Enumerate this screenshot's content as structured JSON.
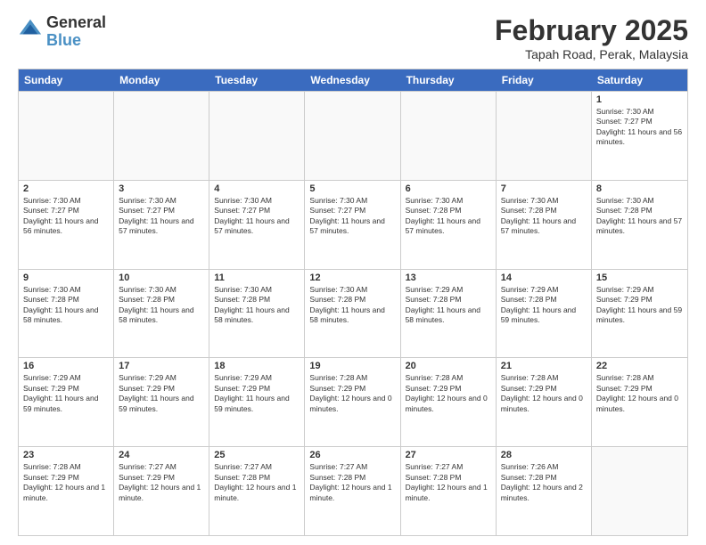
{
  "header": {
    "logo_general": "General",
    "logo_blue": "Blue",
    "month_year": "February 2025",
    "location": "Tapah Road, Perak, Malaysia"
  },
  "calendar": {
    "days_of_week": [
      "Sunday",
      "Monday",
      "Tuesday",
      "Wednesday",
      "Thursday",
      "Friday",
      "Saturday"
    ],
    "weeks": [
      [
        {
          "day": "",
          "info": ""
        },
        {
          "day": "",
          "info": ""
        },
        {
          "day": "",
          "info": ""
        },
        {
          "day": "",
          "info": ""
        },
        {
          "day": "",
          "info": ""
        },
        {
          "day": "",
          "info": ""
        },
        {
          "day": "1",
          "info": "Sunrise: 7:30 AM\nSunset: 7:27 PM\nDaylight: 11 hours and 56 minutes."
        }
      ],
      [
        {
          "day": "2",
          "info": "Sunrise: 7:30 AM\nSunset: 7:27 PM\nDaylight: 11 hours and 56 minutes."
        },
        {
          "day": "3",
          "info": "Sunrise: 7:30 AM\nSunset: 7:27 PM\nDaylight: 11 hours and 57 minutes."
        },
        {
          "day": "4",
          "info": "Sunrise: 7:30 AM\nSunset: 7:27 PM\nDaylight: 11 hours and 57 minutes."
        },
        {
          "day": "5",
          "info": "Sunrise: 7:30 AM\nSunset: 7:27 PM\nDaylight: 11 hours and 57 minutes."
        },
        {
          "day": "6",
          "info": "Sunrise: 7:30 AM\nSunset: 7:28 PM\nDaylight: 11 hours and 57 minutes."
        },
        {
          "day": "7",
          "info": "Sunrise: 7:30 AM\nSunset: 7:28 PM\nDaylight: 11 hours and 57 minutes."
        },
        {
          "day": "8",
          "info": "Sunrise: 7:30 AM\nSunset: 7:28 PM\nDaylight: 11 hours and 57 minutes."
        }
      ],
      [
        {
          "day": "9",
          "info": "Sunrise: 7:30 AM\nSunset: 7:28 PM\nDaylight: 11 hours and 58 minutes."
        },
        {
          "day": "10",
          "info": "Sunrise: 7:30 AM\nSunset: 7:28 PM\nDaylight: 11 hours and 58 minutes."
        },
        {
          "day": "11",
          "info": "Sunrise: 7:30 AM\nSunset: 7:28 PM\nDaylight: 11 hours and 58 minutes."
        },
        {
          "day": "12",
          "info": "Sunrise: 7:30 AM\nSunset: 7:28 PM\nDaylight: 11 hours and 58 minutes."
        },
        {
          "day": "13",
          "info": "Sunrise: 7:29 AM\nSunset: 7:28 PM\nDaylight: 11 hours and 58 minutes."
        },
        {
          "day": "14",
          "info": "Sunrise: 7:29 AM\nSunset: 7:28 PM\nDaylight: 11 hours and 59 minutes."
        },
        {
          "day": "15",
          "info": "Sunrise: 7:29 AM\nSunset: 7:29 PM\nDaylight: 11 hours and 59 minutes."
        }
      ],
      [
        {
          "day": "16",
          "info": "Sunrise: 7:29 AM\nSunset: 7:29 PM\nDaylight: 11 hours and 59 minutes."
        },
        {
          "day": "17",
          "info": "Sunrise: 7:29 AM\nSunset: 7:29 PM\nDaylight: 11 hours and 59 minutes."
        },
        {
          "day": "18",
          "info": "Sunrise: 7:29 AM\nSunset: 7:29 PM\nDaylight: 11 hours and 59 minutes."
        },
        {
          "day": "19",
          "info": "Sunrise: 7:28 AM\nSunset: 7:29 PM\nDaylight: 12 hours and 0 minutes."
        },
        {
          "day": "20",
          "info": "Sunrise: 7:28 AM\nSunset: 7:29 PM\nDaylight: 12 hours and 0 minutes."
        },
        {
          "day": "21",
          "info": "Sunrise: 7:28 AM\nSunset: 7:29 PM\nDaylight: 12 hours and 0 minutes."
        },
        {
          "day": "22",
          "info": "Sunrise: 7:28 AM\nSunset: 7:29 PM\nDaylight: 12 hours and 0 minutes."
        }
      ],
      [
        {
          "day": "23",
          "info": "Sunrise: 7:28 AM\nSunset: 7:29 PM\nDaylight: 12 hours and 1 minute."
        },
        {
          "day": "24",
          "info": "Sunrise: 7:27 AM\nSunset: 7:29 PM\nDaylight: 12 hours and 1 minute."
        },
        {
          "day": "25",
          "info": "Sunrise: 7:27 AM\nSunset: 7:28 PM\nDaylight: 12 hours and 1 minute."
        },
        {
          "day": "26",
          "info": "Sunrise: 7:27 AM\nSunset: 7:28 PM\nDaylight: 12 hours and 1 minute."
        },
        {
          "day": "27",
          "info": "Sunrise: 7:27 AM\nSunset: 7:28 PM\nDaylight: 12 hours and 1 minute."
        },
        {
          "day": "28",
          "info": "Sunrise: 7:26 AM\nSunset: 7:28 PM\nDaylight: 12 hours and 2 minutes."
        },
        {
          "day": "",
          "info": ""
        }
      ]
    ]
  }
}
